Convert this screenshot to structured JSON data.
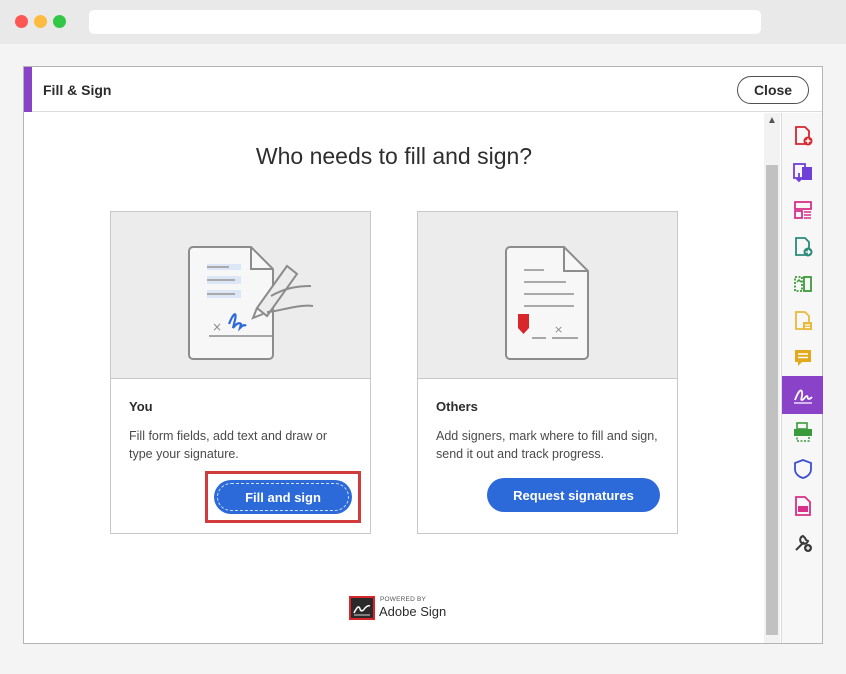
{
  "panel": {
    "title": "Fill & Sign",
    "close_label": "Close"
  },
  "main": {
    "heading": "Who needs to fill and sign?",
    "cards": [
      {
        "title": "You",
        "description": "Fill form fields, add text and draw or type your signature.",
        "button_label": "Fill and sign",
        "illustration": "sign-document-pen-icon"
      },
      {
        "title": "Others",
        "description": "Add signers, mark where to fill and sign, send it out and track progress.",
        "button_label": "Request signatures",
        "illustration": "document-signature-field-icon"
      }
    ],
    "powered_by": {
      "small": "POWERED BY",
      "brand": "Adobe Sign"
    }
  },
  "tools_rail": [
    {
      "icon": "create-pdf-icon",
      "color": "#d8262c"
    },
    {
      "icon": "export-pdf-icon",
      "color": "#6f3fd8"
    },
    {
      "icon": "organize-pages-icon",
      "color": "#d8308a"
    },
    {
      "icon": "send-file-icon",
      "color": "#2b8a7a"
    },
    {
      "icon": "compare-files-icon",
      "color": "#3a9b3a"
    },
    {
      "icon": "edit-pdf-icon",
      "color": "#e8b93a"
    },
    {
      "icon": "comment-icon",
      "color": "#e2a91a"
    },
    {
      "icon": "fill-sign-icon",
      "color": "#ffffff",
      "active": true
    },
    {
      "icon": "scan-ocr-icon",
      "color": "#3a9b3a"
    },
    {
      "icon": "protect-icon",
      "color": "#3b4fd0"
    },
    {
      "icon": "export-file-icon",
      "color": "#d8308a"
    },
    {
      "icon": "more-tools-icon",
      "color": "#3a3a3a"
    }
  ],
  "colors": {
    "accent": "#8a42c9",
    "primary_button": "#2d6ad9",
    "highlight": "#d23b3b"
  }
}
